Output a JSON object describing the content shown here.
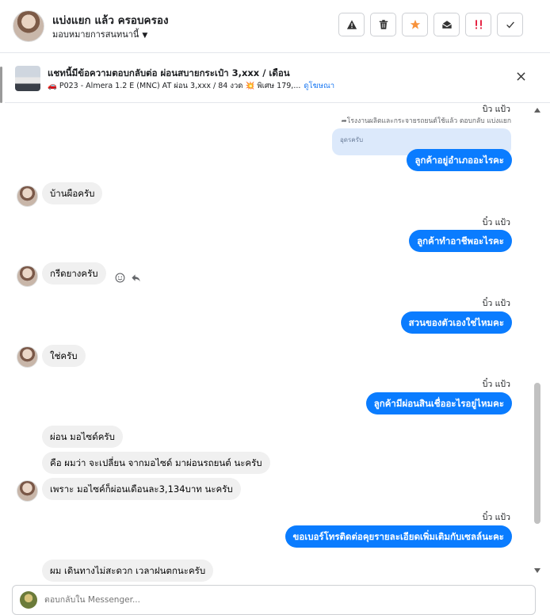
{
  "header": {
    "contact_name": "แบ่งแยก แล้ว ครอบครอง",
    "assign_label": "มอบหมายการสนทนานี้",
    "buttons": [
      "warning-icon",
      "trash-icon",
      "star-icon",
      "mark-unread-icon",
      "spam-icon",
      "done-icon"
    ],
    "star_color": "#f7923b",
    "spam_color": "#e41e3f"
  },
  "banner": {
    "title": "แชทนี้มีข้อความตอบกลับต่อ ผ่อนสบายกระเป๋า 3,xxx / เดือน",
    "subtitle": "🚗 P023 - Almera 1.2 E (MNC) AT ผ่อน 3,xxx / 84 งวด 💥 พิเศษ 179,...",
    "view_ad": "ดูโฆษณา"
  },
  "thread": {
    "top_name": "บิว แป้ว",
    "reply_note": "โรงงานผลิตและกระจายรถยนต์ใช้แล้ว ตอบกลับ แบ่งแยก",
    "quoted_text": "อุดรครับ",
    "messages": [
      {
        "dir": "out",
        "text": "ลูกค้าอยู่อำเภออะไรคะ"
      },
      {
        "dir": "in",
        "text": "บ้านผือครับ"
      },
      {
        "dir": "name",
        "text": "บิ๋ว แป้ว"
      },
      {
        "dir": "out",
        "text": "ลูกค้าทำอาชีพอะไรคะ"
      },
      {
        "dir": "in",
        "text": "กรีดยางครับ"
      },
      {
        "dir": "name",
        "text": "บิ๋ว แป้ว"
      },
      {
        "dir": "out",
        "text": "สวนของตัวเองใช่ไหมคะ"
      },
      {
        "dir": "in",
        "text": "ใช่ครับ"
      },
      {
        "dir": "name",
        "text": "บิ๋ว แป้ว"
      },
      {
        "dir": "out",
        "text": "ลูกค้ามีผ่อนสินเชื่ออะไรอยู่ไหมคะ"
      },
      {
        "dir": "in",
        "text": "ผ่อน มอไซด์ครับ"
      },
      {
        "dir": "in",
        "text": "คือ ผมว่า จะเปลี่ยน จากมอไซด์ มาผ่อนรถยนต์ นะครับ"
      },
      {
        "dir": "in",
        "text": "เพราะ มอไซค์ก็ผ่อนเดือนละ3,134บาท นะครับ"
      },
      {
        "dir": "name",
        "text": "บิ๋ว แป้ว"
      },
      {
        "dir": "out",
        "text": "ขอเบอร์โทรติดต่อคุยรายละเอียดเพิ่มเติมกับเซลล์นะคะ"
      },
      {
        "dir": "in",
        "text": "ผม เดินทางไม่สะดวก เวลาฝนตกนะครับ"
      }
    ]
  },
  "composer": {
    "placeholder": "ตอบกลับใน Messenger..."
  },
  "colors": {
    "outgoing_bubble": "#0a7cff",
    "incoming_bubble": "#f0f0f0",
    "quoted_bubble": "#dce9fb"
  }
}
